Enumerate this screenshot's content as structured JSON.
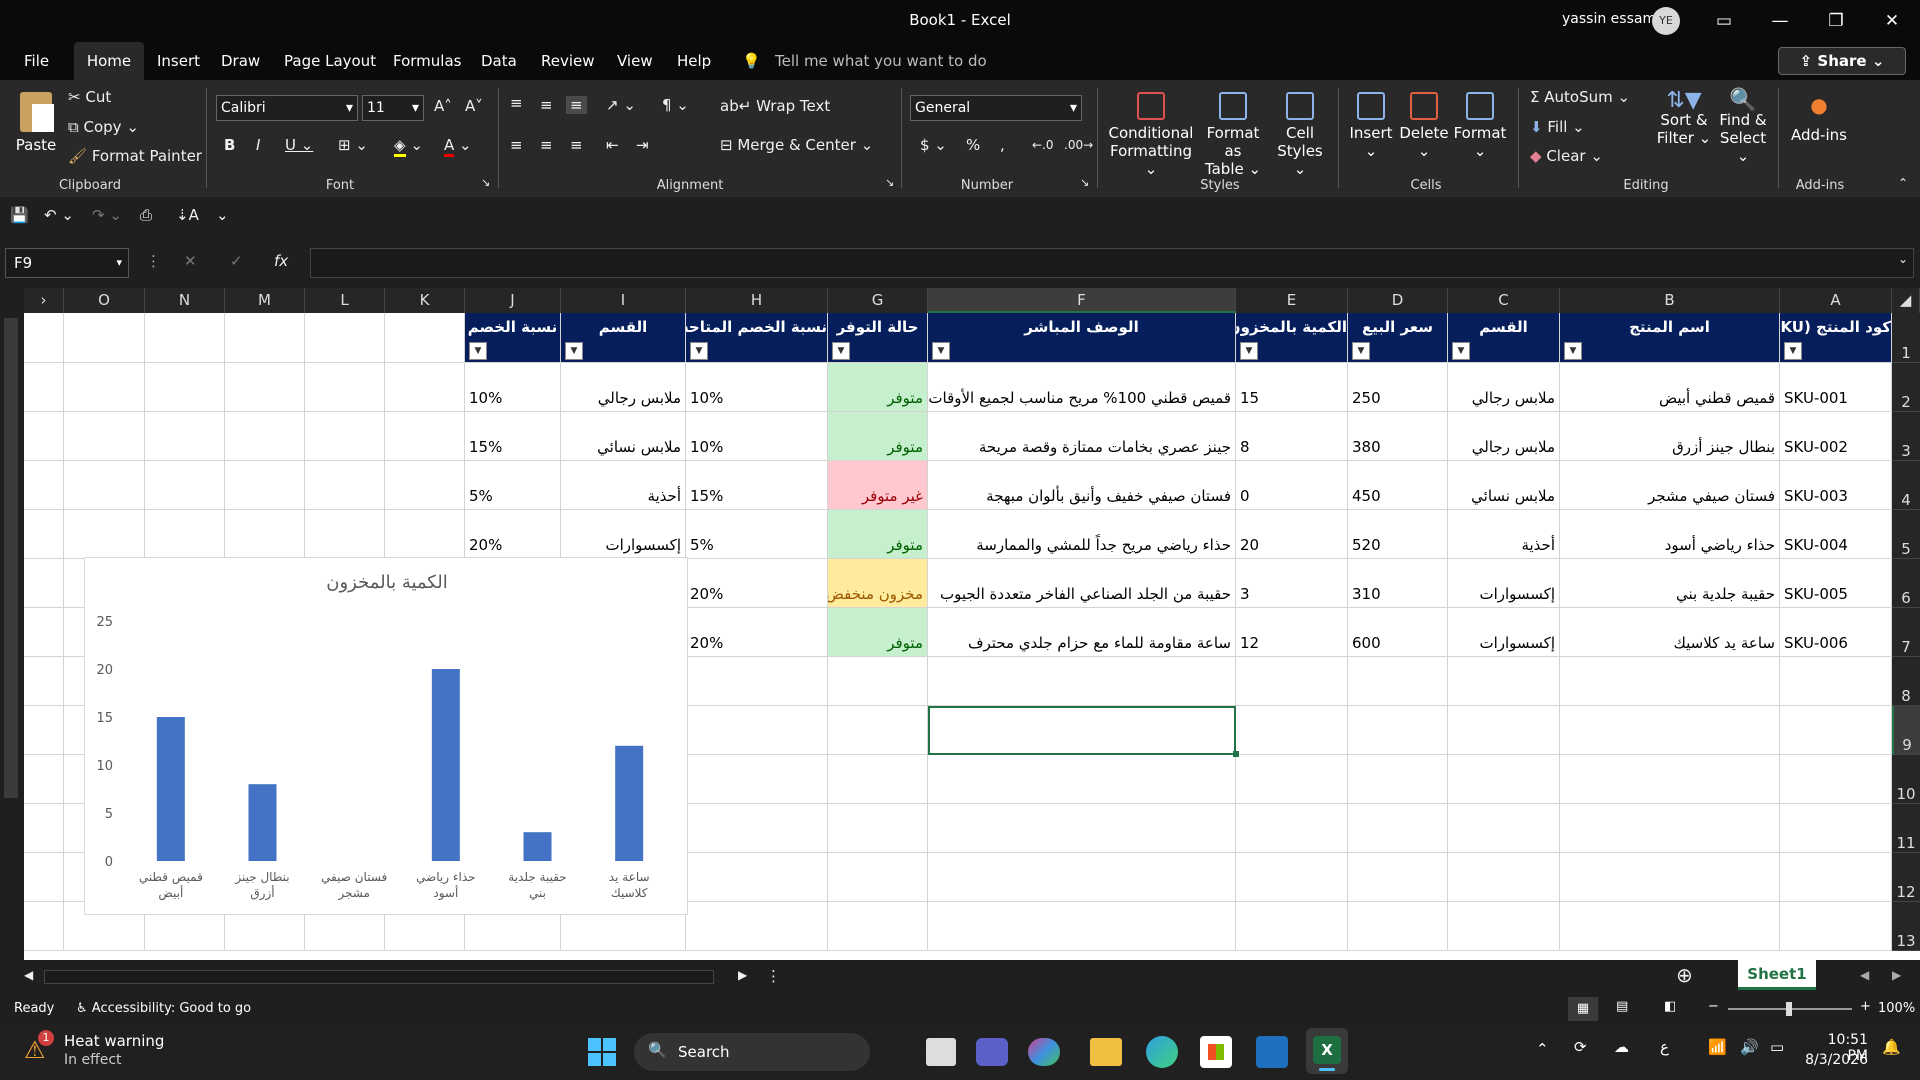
{
  "window": {
    "title": "Book1  -  Excel",
    "user": "yassin essam",
    "avatar": "YE"
  },
  "menu": [
    "File",
    "Home",
    "Insert",
    "Draw",
    "Page Layout",
    "Formulas",
    "Data",
    "Review",
    "View",
    "Help"
  ],
  "tell_me": "Tell me what you want to do",
  "share": "Share",
  "ribbon": {
    "paste": "Paste",
    "cut": "Cut",
    "copy": "Copy",
    "format_painter": "Format Painter",
    "clipboard": "Clipboard",
    "font_name": "Calibri",
    "font_size": "11",
    "font": "Font",
    "wrap_text": "Wrap Text",
    "merge_center": "Merge & Center",
    "alignment": "Alignment",
    "number_format": "General",
    "number": "Number",
    "conditional": "Conditional",
    "formatting": "Formatting",
    "format_as": "Format as",
    "table": "Table",
    "cell": "Cell",
    "styles_btn": "Styles",
    "styles": "Styles",
    "insert": "Insert",
    "delete": "Delete",
    "format": "Format",
    "cells": "Cells",
    "autosum": "AutoSum",
    "fill": "Fill",
    "clear": "Clear",
    "sort": "Sort &",
    "filter": "Filter",
    "find": "Find &",
    "select": "Select",
    "editing": "Editing",
    "addins": "Add-ins",
    "addins_grp": "Add-ins"
  },
  "namebox": "F9",
  "columns": [
    "A",
    "B",
    "C",
    "D",
    "E",
    "F",
    "G",
    "H",
    "I",
    "J",
    "K",
    "L",
    "M",
    "N",
    "O"
  ],
  "rows": [
    "1",
    "2",
    "3",
    "4",
    "5",
    "6",
    "7",
    "8",
    "9",
    "10",
    "11",
    "12",
    "13"
  ],
  "headers": {
    "A": "كود المنتج (SKU)",
    "B": "اسم المنتج",
    "C": "القسم",
    "D": "سعر البيع",
    "E": "الكمية بالمخزون",
    "F": "الوصف المباشر",
    "G": "حالة التوفر",
    "H": "نسبة الخصم المتاحة",
    "I": "القسم",
    "J": "نسبة الخصم"
  },
  "data": [
    {
      "A": "SKU-001",
      "B": "قميص قطني أبيض",
      "C": "ملابس رجالي",
      "D": "250",
      "E": "15",
      "F": "قميص قطني 100% مريح مناسب لجميع الأوقات",
      "G": "متوفر",
      "H": "10%",
      "I": "ملابس رجالي",
      "J": "10%"
    },
    {
      "A": "SKU-002",
      "B": "بنطال جينز أزرق",
      "C": "ملابس رجالي",
      "D": "380",
      "E": "8",
      "F": "جينز عصري بخامات ممتازة وقصة مريحة",
      "G": "متوفر",
      "H": "10%",
      "I": "ملابس نسائي",
      "J": "15%"
    },
    {
      "A": "SKU-003",
      "B": "فستان صيفي مشجر",
      "C": "ملابس نسائي",
      "D": "450",
      "E": "0",
      "F": "فستان صيفي خفيف وأنيق بألوان مبهجة",
      "G": "غير متوفر",
      "H": "15%",
      "I": "أحذية",
      "J": "5%"
    },
    {
      "A": "SKU-004",
      "B": "حذاء رياضي أسود",
      "C": "أحذية",
      "D": "520",
      "E": "20",
      "F": "حذاء رياضي مريح جداً للمشي والممارسة",
      "G": "متوفر",
      "H": "5%",
      "I": "إكسسوارات",
      "J": "20%"
    },
    {
      "A": "SKU-005",
      "B": "حقيبة جلدية بني",
      "C": "إكسسوارات",
      "D": "310",
      "E": "3",
      "F": "حقيبة من الجلد الصناعي الفاخر متعددة الجيوب",
      "G": "مخزون منخفض",
      "H": "20%",
      "I": "",
      "J": ""
    },
    {
      "A": "SKU-006",
      "B": "ساعة يد كلاسيك",
      "C": "إكسسوارات",
      "D": "600",
      "E": "12",
      "F": "ساعة مقاومة للماء مع حزام جلدي محترف",
      "G": "متوفر",
      "H": "20%",
      "I": "",
      "J": ""
    }
  ],
  "status_colors": {
    "متوفر": "#c6efce",
    "غير متوفر": "#ffc7ce",
    "مخزون منخفض": "#ffeb9c"
  },
  "status_text_colors": {
    "متوفر": "#006100",
    "غير متوفر": "#9c0006",
    "مخزون منخفض": "#9c5700"
  },
  "chart_data": {
    "type": "bar",
    "title": "الكمية بالمخزون",
    "categories": [
      "قميص قطني أبيض",
      "بنطال جينز أزرق",
      "فستان صيفي مشجر",
      "حذاء رياضي أسود",
      "حقيبة جلدية بني",
      "ساعة يد كلاسيك"
    ],
    "values": [
      15,
      8,
      0,
      20,
      3,
      12
    ],
    "ylim": [
      0,
      25
    ],
    "yticks": [
      0,
      5,
      10,
      15,
      20,
      25
    ],
    "grid": false,
    "color": "#4472c4"
  },
  "sheet_tab": "Sheet1",
  "status": {
    "ready": "Ready",
    "accessibility": "Accessibility: Good to go",
    "zoom": "100%"
  },
  "taskbar": {
    "weather_title": "Heat warning",
    "weather_sub": "In effect",
    "badge": "1",
    "search": "Search",
    "time": "10:51 PM",
    "date": "8/3/2026",
    "lang": "ع"
  }
}
